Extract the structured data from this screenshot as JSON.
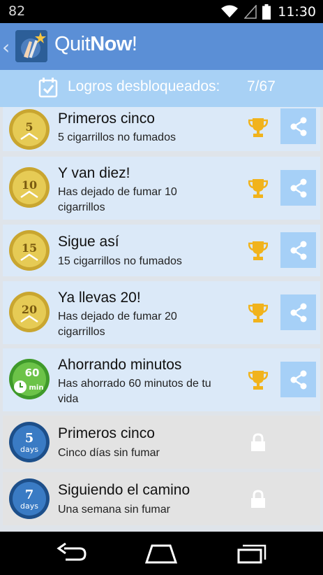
{
  "status_bar": {
    "battery_level_text": "82",
    "time": "11:30",
    "icons": [
      "wifi-icon",
      "signal-icon",
      "battery-icon"
    ]
  },
  "app_bar": {
    "title_part1": "Quit",
    "title_part2": "Now",
    "title_part3": "!",
    "icons": [
      "back-chevron-icon",
      "app-logo-icon"
    ]
  },
  "achievements_header": {
    "label": "Logros desbloqueados:",
    "count": "7/67",
    "icon": "calendar-check-icon"
  },
  "achievements": [
    {
      "badge_text": "5",
      "title": "Primeros cinco",
      "description": "5 cigarrillos no fumados",
      "unlocked": true,
      "badge_color": "#e3c64f"
    },
    {
      "badge_text": "10",
      "title": "Y van diez!",
      "description": "Has dejado de fumar 10 cigarrillos",
      "unlocked": true,
      "badge_color": "#e3c64f"
    },
    {
      "badge_text": "15",
      "title": "Sigue así",
      "description": "15 cigarrillos no fumados",
      "unlocked": true,
      "badge_color": "#e3c64f"
    },
    {
      "badge_text": "20",
      "title": "Ya llevas 20!",
      "description": "Has dejado de fumar 20 cigarrillos",
      "unlocked": true,
      "badge_color": "#e3c64f"
    },
    {
      "badge_text": "60",
      "badge_subtext": "min",
      "title": "Ahorrando minutos",
      "description": "Has ahorrado 60 minutos de tu vida",
      "unlocked": true,
      "badge_color": "#5cb83a"
    },
    {
      "badge_text": "5",
      "badge_subtext": "days",
      "title": "Primeros cinco",
      "description": "Cinco días sin fumar",
      "unlocked": false,
      "badge_color": "#2f6fb4"
    },
    {
      "badge_text": "7",
      "badge_subtext": "days",
      "title": "Siguiendo el camino",
      "description": "Una semana sin fumar",
      "unlocked": false,
      "badge_color": "#2f6fb4"
    }
  ],
  "colors": {
    "app_bar": "#5b8fd6",
    "achievement_bar": "#a8d1f5",
    "unlocked_row": "#dbe9f8",
    "locked_row": "#e3e3e3",
    "trophy": "#f1b31c",
    "share_button": "#a6d0f7"
  },
  "nav_bar": {
    "icons": [
      "back-icon",
      "home-icon",
      "recent-apps-icon"
    ]
  }
}
